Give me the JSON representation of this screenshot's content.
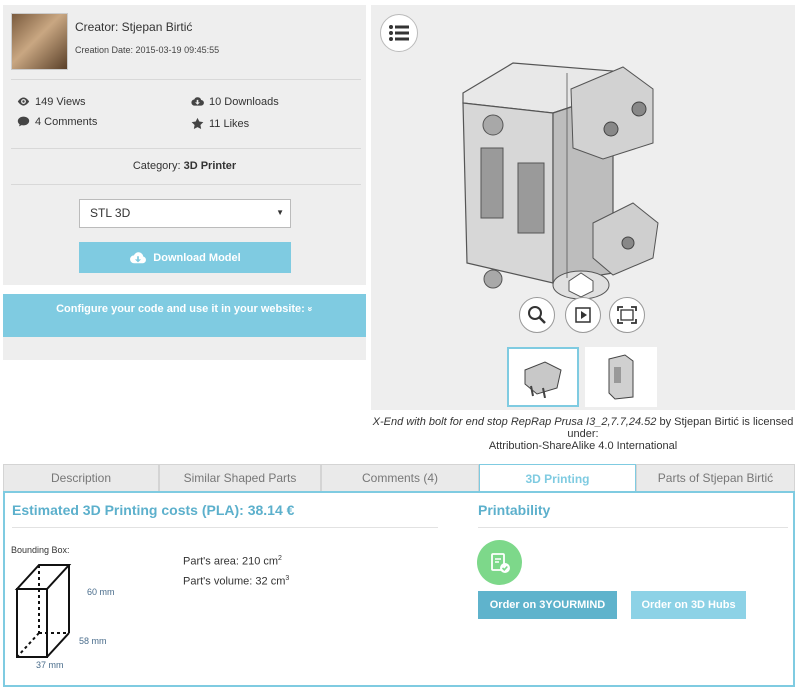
{
  "creator": {
    "name": "Creator: Stjepan Birtić",
    "creation_date": "Creation Date: 2015-03-19 09:45:55"
  },
  "stats": {
    "views": "149 Views",
    "comments": "4 Comments",
    "downloads": "10 Downloads",
    "likes": "11 Likes"
  },
  "category": {
    "label": "Category:",
    "value": "3D Printer"
  },
  "format_select": {
    "value": "STL 3D"
  },
  "download_button": "Download Model",
  "configure": {
    "label": "Configure your code and use it in your website:",
    "chevron": "»"
  },
  "license": {
    "title": "X-End with bolt for end stop RepRap Prusa I3_2,7.7,24.52",
    "by": " by Stjepan Birtić is licensed under:",
    "name": "Attribution-ShareAlike 4.0 International"
  },
  "tabs": [
    {
      "label": "Description"
    },
    {
      "label": "Similar Shaped Parts"
    },
    {
      "label": "Comments (4)"
    },
    {
      "label": "3D Printing"
    },
    {
      "label": "Parts of Stjepan Birtić"
    }
  ],
  "printing": {
    "cost_heading": "Estimated 3D Printing costs (PLA): 38.14 €",
    "printability_heading": "Printability",
    "bbox_label": "Bounding Box:",
    "area_label": "Part's area: 210 cm",
    "area_sup": "2",
    "volume_label": "Part's volume: 32 cm",
    "volume_sup": "3",
    "dim_height": "60 mm",
    "dim_depth": "58 mm",
    "dim_width": "37 mm",
    "order_3yourmind": "Order on 3YOURMIND",
    "order_3dhubs": "Order on 3D Hubs"
  },
  "colors": {
    "accent": "#7fcbe1",
    "accent_dark": "#5cb0cc",
    "printable_green": "#7dd88a",
    "panel_bg": "#eeeeee"
  },
  "icons": [
    "eye-icon",
    "comment-icon",
    "cloud-download-icon",
    "star-icon",
    "list-menu-icon",
    "zoom-icon",
    "play-icon",
    "fullscreen-icon",
    "printable-check-icon"
  ]
}
